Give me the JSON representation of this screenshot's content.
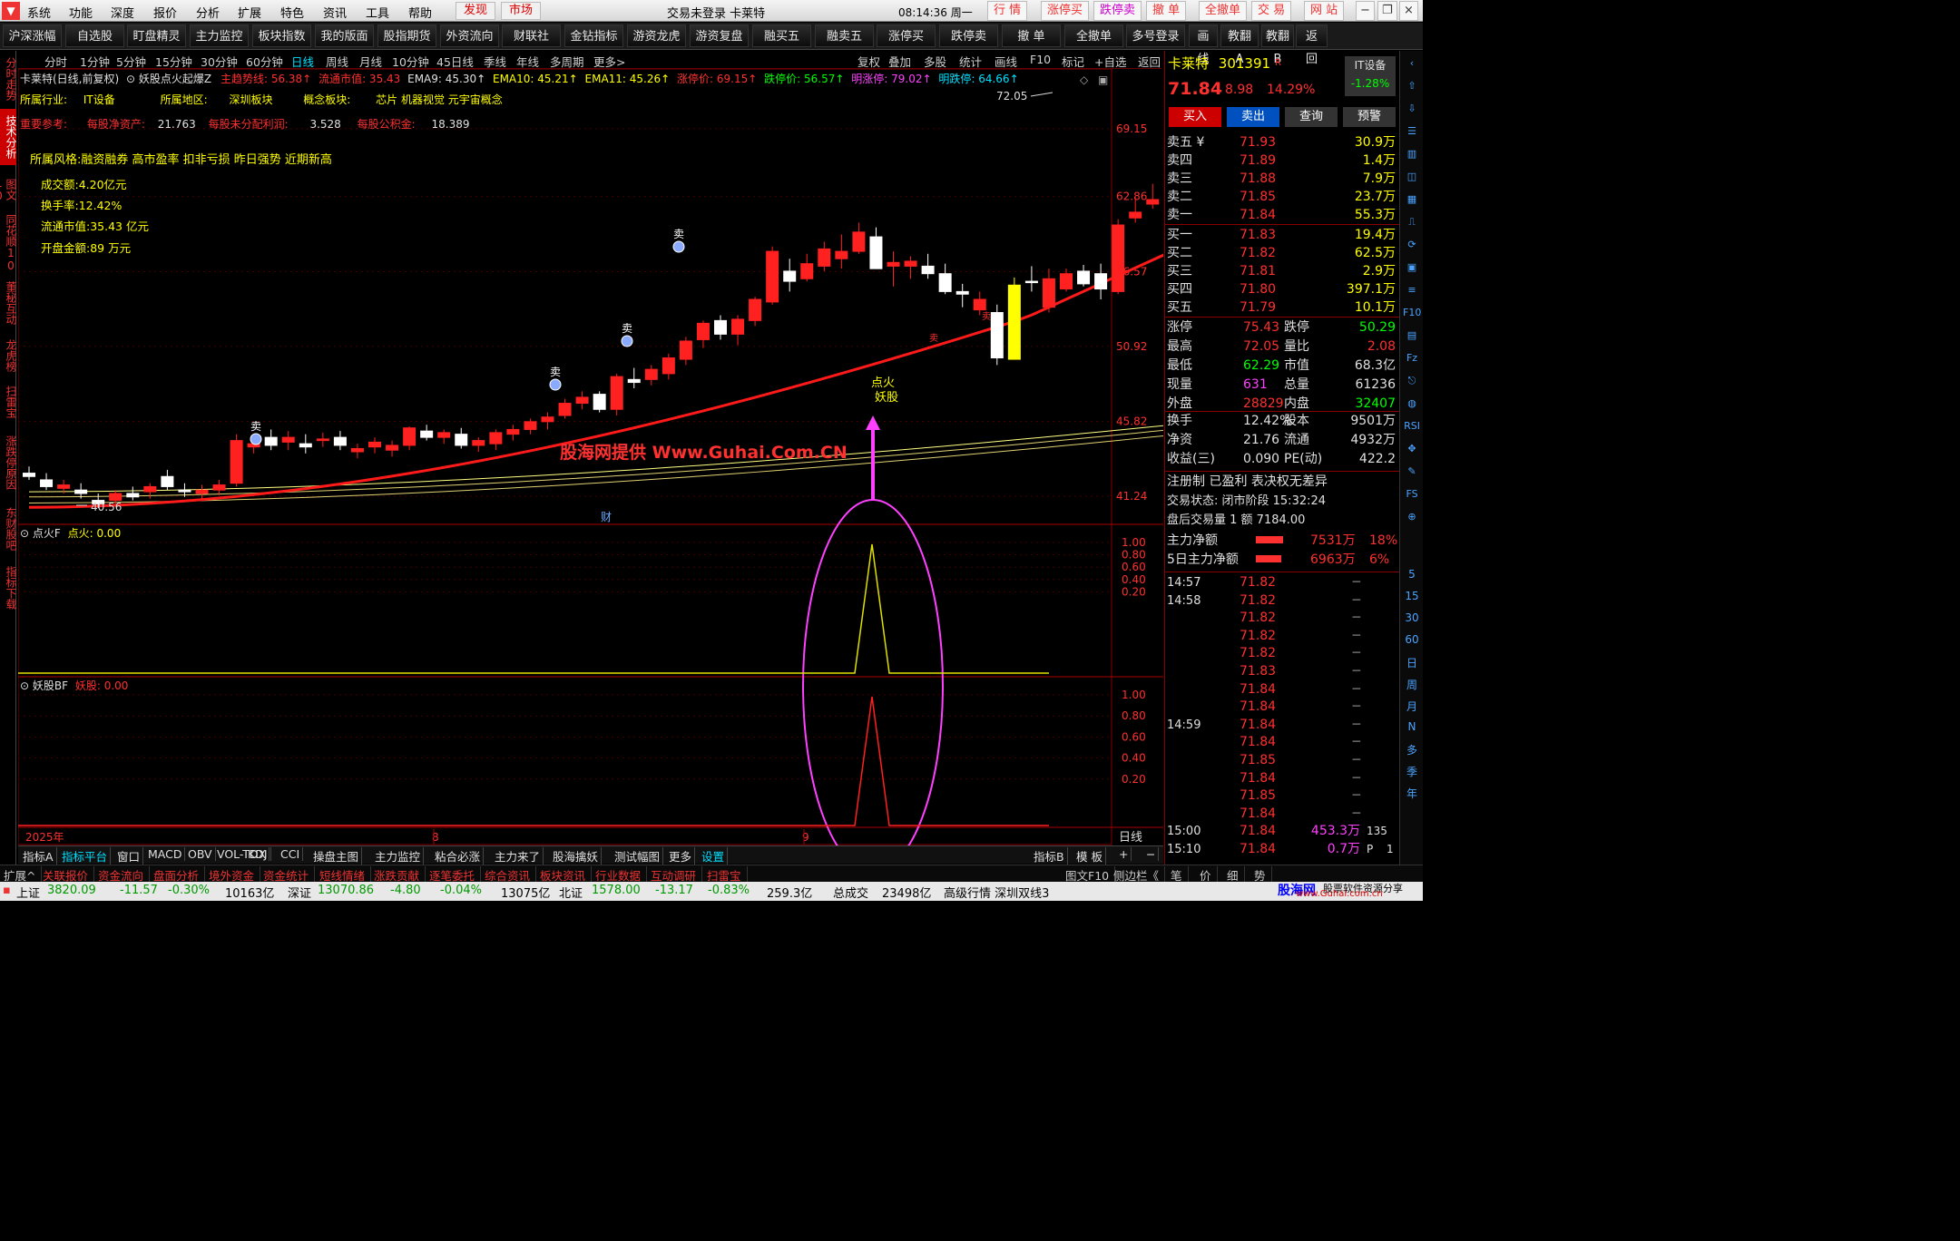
{
  "menubar": {
    "items": [
      "系统",
      "功能",
      "深度",
      "报价",
      "分析",
      "扩展",
      "特色",
      "资讯",
      "工具",
      "帮助"
    ],
    "discover": "发现",
    "market": "市场",
    "title": "交易未登录 卡莱特",
    "clock": "08:14:36 周一",
    "quick": [
      "行 情",
      "涨停买",
      "跌停卖",
      "撤 单",
      "全撤单",
      "交 易",
      "网 站"
    ]
  },
  "toolbar": {
    "buttons": [
      "沪深涨幅",
      "自选股",
      "盯盘精灵",
      "主力监控",
      "板块指数",
      "我的版面",
      "股指期货",
      "外资流向",
      "财联社",
      "金钻指标",
      "游资龙虎",
      "游资复盘",
      "融买五",
      "融卖五",
      "涨停买",
      "跌停卖",
      "撤 单",
      "全撤单",
      "多号登录",
      "画线",
      "教翻A",
      "教翻B",
      "返回"
    ]
  },
  "lefttabs": [
    "分时走势",
    "技术分析",
    "图文10",
    "同花顺10",
    "董秘互动",
    "龙虎榜",
    "扫雷宝",
    "涨跌停原因",
    "东财股吧",
    "指标下载"
  ],
  "periods": [
    "分时",
    "1分钟",
    "5分钟",
    "15分钟",
    "30分钟",
    "60分钟",
    "日线",
    "周线",
    "月线",
    "10分钟",
    "45日线",
    "季线",
    "年线",
    "多周期",
    "更多>"
  ],
  "period_tools": [
    "复权",
    "叠加",
    "多股",
    "统计",
    "画线",
    "F10",
    "标记",
    "+自选",
    "返回"
  ],
  "chart_header": {
    "name": "卡莱特(日线,前复权)",
    "indicator": "妖股点火起爆Z",
    "zhuli": "主趋势线: 56.38↑",
    "ltsz": "流通市值: 35.43",
    "ema9": "EMA9: 45.30↑",
    "ema10": "EMA10: 45.21↑",
    "ema11": "EMA11: 45.26↑",
    "ztj": "涨停价: 69.15↑",
    "dtj": "跌停价: 56.57↑",
    "mzt": "明涨停: 79.02↑",
    "mdt": "明跌停: 64.66↑"
  },
  "info_lines": {
    "industry_label": "所属行业:",
    "industry": "IT设备",
    "region_label": "所属地区:",
    "region": "深圳板块",
    "concept_label": "概念板块:",
    "concept": "芯片 机器视觉 元宇宙概念",
    "ref_label": "重要参考:",
    "nav_label": "每股净资产:",
    "nav": "21.763",
    "undist_label": "每股未分配利润:",
    "undist": "3.528",
    "reserve_label": "每股公积金:",
    "reserve": "18.389",
    "style": "所属风格:融资融券 高市盈率 扣非亏损 昨日强势 近期新高",
    "turnover_amt": "成交额:4.20亿元",
    "turnover_rate": "换手率:12.42%",
    "float_cap": "流通市值:35.43 亿元",
    "open_amt": "开盘金额:89 万元"
  },
  "chart_text": {
    "watermark": "股海网提供 Www.Guhai.Com.CN",
    "dianhuo": "点火",
    "yaogu": "妖股",
    "high": "72.05",
    "low": "40.56",
    "cai": "财",
    "sell": "卖",
    "y_axis": [
      "69.15",
      "62.86",
      "56.57",
      "50.92",
      "45.82",
      "41.24"
    ],
    "x_axis": [
      "2025年",
      "8",
      "9"
    ],
    "rixian": "日线"
  },
  "chart_data": {
    "type": "candlestick",
    "title": "卡莱特(日线,前复权)",
    "ylim": [
      40.56,
      72.05
    ],
    "candles": [
      [
        42.6,
        43.0,
        42.2,
        42.4
      ],
      [
        42.2,
        42.6,
        41.6,
        41.8
      ],
      [
        41.7,
        42.2,
        41.4,
        41.9
      ],
      [
        41.6,
        42.0,
        41.1,
        41.4
      ],
      [
        41.0,
        41.4,
        40.56,
        40.8
      ],
      [
        41.0,
        41.6,
        40.8,
        41.4
      ],
      [
        41.4,
        41.8,
        41.0,
        41.2
      ],
      [
        41.5,
        42.0,
        41.1,
        41.8
      ],
      [
        42.4,
        42.8,
        41.6,
        41.8
      ],
      [
        41.6,
        42.0,
        41.2,
        41.5
      ],
      [
        41.4,
        41.9,
        41.0,
        41.6
      ],
      [
        41.6,
        42.2,
        41.3,
        41.9
      ],
      [
        42.0,
        45.0,
        41.8,
        44.6
      ],
      [
        44.2,
        45.0,
        43.8,
        44.4
      ],
      [
        44.8,
        45.3,
        44.0,
        44.3
      ],
      [
        44.5,
        45.2,
        44.0,
        44.8
      ],
      [
        44.4,
        45.0,
        43.8,
        44.2
      ],
      [
        44.6,
        45.1,
        44.2,
        44.7
      ],
      [
        44.8,
        45.2,
        44.0,
        44.3
      ],
      [
        43.9,
        44.4,
        43.5,
        44.1
      ],
      [
        44.2,
        44.8,
        43.8,
        44.5
      ],
      [
        44.0,
        44.6,
        43.6,
        44.3
      ],
      [
        44.3,
        45.5,
        44.0,
        45.4
      ],
      [
        45.2,
        45.6,
        44.6,
        44.8
      ],
      [
        44.8,
        45.3,
        44.4,
        45.1
      ],
      [
        45.0,
        45.4,
        44.1,
        44.3
      ],
      [
        44.3,
        44.8,
        43.9,
        44.6
      ],
      [
        44.4,
        45.3,
        44.0,
        45.1
      ],
      [
        45.0,
        45.6,
        44.6,
        45.3
      ],
      [
        45.3,
        46.0,
        45.0,
        45.8
      ],
      [
        45.8,
        46.4,
        45.3,
        46.1
      ],
      [
        46.2,
        47.3,
        46.0,
        47.0
      ],
      [
        47.0,
        47.8,
        46.6,
        47.4
      ],
      [
        47.6,
        47.8,
        46.4,
        46.6
      ],
      [
        46.6,
        49.0,
        46.2,
        48.8
      ],
      [
        48.6,
        49.4,
        48.0,
        48.4
      ],
      [
        48.6,
        49.6,
        48.2,
        49.3
      ],
      [
        49.0,
        50.4,
        48.6,
        50.1
      ],
      [
        50.0,
        51.6,
        49.6,
        51.3
      ],
      [
        51.4,
        52.8,
        50.8,
        52.6
      ],
      [
        52.8,
        53.2,
        51.4,
        51.8
      ],
      [
        51.8,
        53.2,
        51.0,
        52.9
      ],
      [
        52.8,
        54.6,
        52.4,
        54.4
      ],
      [
        54.2,
        58.6,
        54.0,
        58.2
      ],
      [
        56.6,
        57.6,
        55.0,
        55.8
      ],
      [
        56.0,
        58.0,
        55.8,
        57.2
      ],
      [
        57.0,
        59.0,
        56.6,
        58.4
      ],
      [
        57.6,
        59.6,
        56.8,
        58.2
      ],
      [
        58.2,
        60.6,
        58.0,
        59.8
      ],
      [
        59.4,
        60.2,
        56.8,
        56.8
      ],
      [
        57.0,
        58.2,
        55.4,
        57.3
      ],
      [
        57.0,
        57.8,
        56.0,
        57.4
      ],
      [
        57.0,
        58.0,
        56.0,
        56.4
      ],
      [
        56.4,
        57.2,
        54.8,
        55.0
      ],
      [
        55.0,
        55.6,
        53.8,
        54.8
      ],
      [
        53.6,
        55.0,
        53.2,
        54.4
      ],
      [
        53.4,
        54.0,
        49.6,
        50.1
      ],
      [
        50.0,
        56.1,
        50.1,
        55.5
      ],
      [
        55.8,
        57.0,
        55.0,
        55.7
      ],
      [
        53.8,
        56.8,
        53.4,
        56.0
      ],
      [
        55.2,
        56.8,
        55.0,
        56.4
      ],
      [
        56.6,
        57.1,
        55.4,
        55.6
      ],
      [
        56.4,
        57.2,
        54.4,
        55.2
      ],
      [
        55.0,
        60.9,
        54.8,
        60.4
      ],
      [
        61.0,
        62.8,
        60.6,
        61.5
      ],
      [
        62.2,
        64.0,
        61.8,
        62.6
      ],
      [
        62.2,
        66.8,
        61.7,
        66.0
      ],
      [
        62.29,
        72.05,
        62.29,
        71.84
      ]
    ],
    "sell_signals": [
      "卖",
      "卖",
      "卖",
      "卖"
    ],
    "signal": "点火 妖股",
    "indicator_1": {
      "name": "点火F",
      "value": "点火: 0.00",
      "ylim": [
        0,
        1
      ]
    },
    "indicator_2": {
      "name": "妖股BF",
      "value": "妖股: 0.00",
      "ylim": [
        0,
        1
      ]
    },
    "ind_ticks": [
      "1.00",
      "0.80",
      "0.60",
      "0.40",
      "0.20"
    ]
  },
  "right": {
    "name": "卡莱特",
    "code": "301391",
    "R": "R",
    "sector": "IT设备",
    "sector_chg": "-1.28%",
    "price": "71.84",
    "chg": "8.98",
    "pct": "14.29%",
    "btn_buy": "买入",
    "btn_sell": "卖出",
    "btn_query": "查询",
    "btn_warn": "预警",
    "sells": [
      [
        "卖五 ¥",
        "71.93",
        "30.9万"
      ],
      [
        "卖四",
        "71.89",
        "1.4万"
      ],
      [
        "卖三",
        "71.88",
        "7.9万"
      ],
      [
        "卖二",
        "71.85",
        "23.7万"
      ],
      [
        "卖一",
        "71.84",
        "55.3万"
      ]
    ],
    "buys": [
      [
        "买一",
        "71.83",
        "19.4万"
      ],
      [
        "买二",
        "71.82",
        "62.5万"
      ],
      [
        "买三",
        "71.81",
        "2.9万"
      ],
      [
        "买四",
        "71.80",
        "397.1万"
      ],
      [
        "买五",
        "71.79",
        "10.1万"
      ]
    ],
    "stats": [
      [
        "涨停",
        "75.43",
        "跌停",
        "50.29"
      ],
      [
        "最高",
        "72.05",
        "量比",
        "2.08"
      ],
      [
        "最低",
        "62.29",
        "市值",
        "68.3亿"
      ],
      [
        "现量",
        "631",
        "总量",
        "61236"
      ],
      [
        "外盘",
        "28829",
        "内盘",
        "32407"
      ]
    ],
    "stats2": [
      [
        "换手",
        "12.42%",
        "股本",
        "9501万"
      ],
      [
        "净资",
        "21.76",
        "流通",
        "4932万"
      ],
      [
        "收益(三)",
        "0.090",
        "PE(动)",
        "422.2"
      ]
    ],
    "reg": "注册制 已盈利 表决权无差异",
    "trade_state": "交易状态: 闭市阶段 15:32:24",
    "after": "盘后交易量 1 额 7184.00",
    "zl": [
      "主力净额",
      "7531万",
      "18%"
    ],
    "zl5": [
      "5日主力净额",
      "6963万",
      "6%"
    ],
    "ticks": [
      [
        "14:57",
        "71.82",
        "─"
      ],
      [
        "14:58",
        "71.82",
        "─"
      ],
      [
        "",
        "71.82",
        "─"
      ],
      [
        "",
        "71.82",
        "─"
      ],
      [
        "",
        "71.82",
        "─"
      ],
      [
        "",
        "71.83",
        "─"
      ],
      [
        "",
        "71.84",
        "─"
      ],
      [
        "",
        "71.84",
        "─"
      ],
      [
        "14:59",
        "71.84",
        "─"
      ],
      [
        "",
        "71.84",
        "─"
      ],
      [
        "",
        "71.85",
        "─"
      ],
      [
        "",
        "71.84",
        "─"
      ],
      [
        "",
        "71.85",
        "─"
      ],
      [
        "",
        "71.84",
        "─"
      ],
      [
        "15:00",
        "71.84",
        "453.3万",
        "135"
      ],
      [
        "15:10",
        "71.84",
        "0.7万",
        "P",
        "1"
      ]
    ]
  },
  "righticons": [
    "5",
    "15",
    "30",
    "60",
    "日",
    "周",
    "月",
    "N",
    "多",
    "季",
    "年"
  ],
  "bottomtabs": [
    "指标A",
    "指标平台",
    "窗口",
    "MACD",
    "OBV",
    "VOL-TDX",
    "KDJ",
    "CCI",
    "操盘主图",
    "主力监控",
    "粘合必涨",
    "主力来了",
    "股海擒妖",
    "测试幅图",
    "更多",
    "设置",
    "指标B",
    "模 板",
    "+",
    "−"
  ],
  "extbar": [
    "扩展^",
    "关联报价",
    "资金流向",
    "盘面分析",
    "境外资金",
    "资金统计",
    "短线情绪",
    "涨跌贡献",
    "逐笔委托",
    "综合资讯",
    "板块资讯",
    "行业数据",
    "互动调研",
    "扫雷宝"
  ],
  "extbar_right": [
    "图文F10",
    "侧边栏《",
    "笔",
    "价",
    "细",
    "势"
  ],
  "status": {
    "sh_label": "上证",
    "sh": "3820.09",
    "sh_chg": "-11.57",
    "sh_pct": "-0.30%",
    "sh_amt": "10163亿",
    "sz_label": "深证",
    "sz": "13070.86",
    "sz_chg": "-4.80",
    "sz_pct": "-0.04%",
    "sz_amt": "13075亿",
    "bz_label": "北证",
    "bz": "1578.00",
    "bz_chg": "-13.17",
    "bz_pct": "-0.83%",
    "bz_amt": "259.3亿",
    "total_label": "总成交",
    "total": "23498亿",
    "feed": "高级行情 深圳双线3",
    "brand": "股海网",
    "brand_sub": "股票软件资源分享",
    "brand_url": "www.Guhai.com.cn"
  }
}
